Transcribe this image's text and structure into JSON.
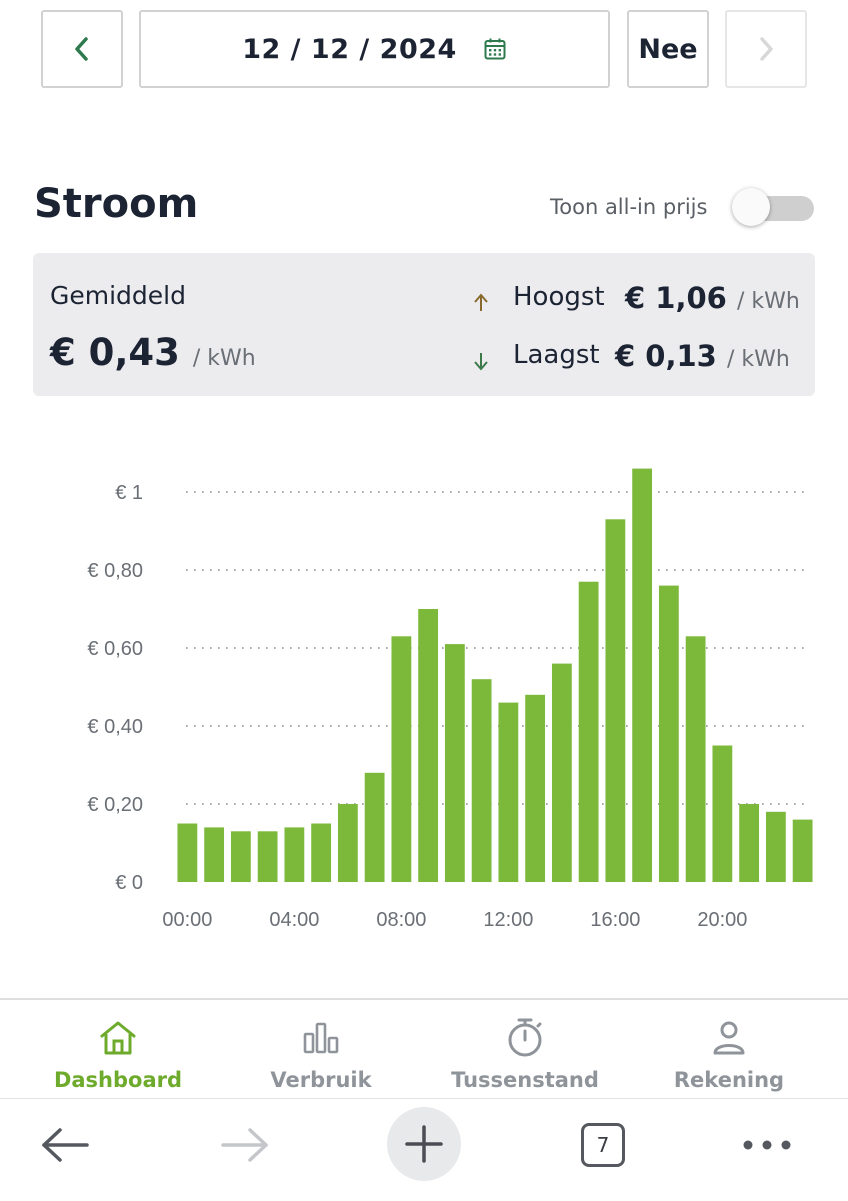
{
  "date_nav": {
    "date": "12 / 12 / 2024",
    "nee_label": "Nee"
  },
  "section": {
    "title": "Stroom",
    "toggle_label": "Toon all-in prijs",
    "toggle_on": false
  },
  "summary": {
    "average_label": "Gemiddeld",
    "average_value": "€ 0,43",
    "unit": "/ kWh",
    "highest_label": "Hoogst",
    "highest_value": "€ 1,06",
    "lowest_label": "Laagst",
    "lowest_value": "€ 0,13"
  },
  "colors": {
    "bar": "#7cb83a",
    "accent": "#6eab2c",
    "text": "#1c2434",
    "up_arrow": "#8a6a2c",
    "down_arrow": "#3c7a4a"
  },
  "chart_data": {
    "type": "bar",
    "title": "",
    "xlabel": "",
    "ylabel": "",
    "x": [
      "00:00",
      "01:00",
      "02:00",
      "03:00",
      "04:00",
      "05:00",
      "06:00",
      "07:00",
      "08:00",
      "09:00",
      "10:00",
      "11:00",
      "12:00",
      "13:00",
      "14:00",
      "15:00",
      "16:00",
      "17:00",
      "18:00",
      "19:00",
      "20:00",
      "21:00",
      "22:00",
      "23:00"
    ],
    "values": [
      0.15,
      0.14,
      0.13,
      0.13,
      0.14,
      0.15,
      0.2,
      0.28,
      0.63,
      0.7,
      0.61,
      0.52,
      0.46,
      0.48,
      0.56,
      0.77,
      0.93,
      1.06,
      0.76,
      0.63,
      0.35,
      0.2,
      0.18,
      0.16
    ],
    "ylim": [
      0,
      1.06
    ],
    "y_ticks": [
      {
        "value": 0,
        "label": "€ 0"
      },
      {
        "value": 0.2,
        "label": "€ 0,20"
      },
      {
        "value": 0.4,
        "label": "€ 0,40"
      },
      {
        "value": 0.6,
        "label": "€ 0,60"
      },
      {
        "value": 0.8,
        "label": "€ 0,80"
      },
      {
        "value": 1.0,
        "label": "€ 1"
      }
    ],
    "x_tick_labels": [
      "00:00",
      "04:00",
      "08:00",
      "12:00",
      "16:00",
      "20:00"
    ],
    "grid": "dotted-horizontal",
    "legend": "none"
  },
  "bottom_nav": {
    "tabs": [
      {
        "label": "Dashboard",
        "icon": "home-icon",
        "active": true
      },
      {
        "label": "Verbruik",
        "icon": "bar-chart-icon",
        "active": false
      },
      {
        "label": "Tussenstand",
        "icon": "stopwatch-icon",
        "active": false
      },
      {
        "label": "Rekening",
        "icon": "person-icon",
        "active": false
      }
    ]
  },
  "browser": {
    "tab_count": "7"
  }
}
